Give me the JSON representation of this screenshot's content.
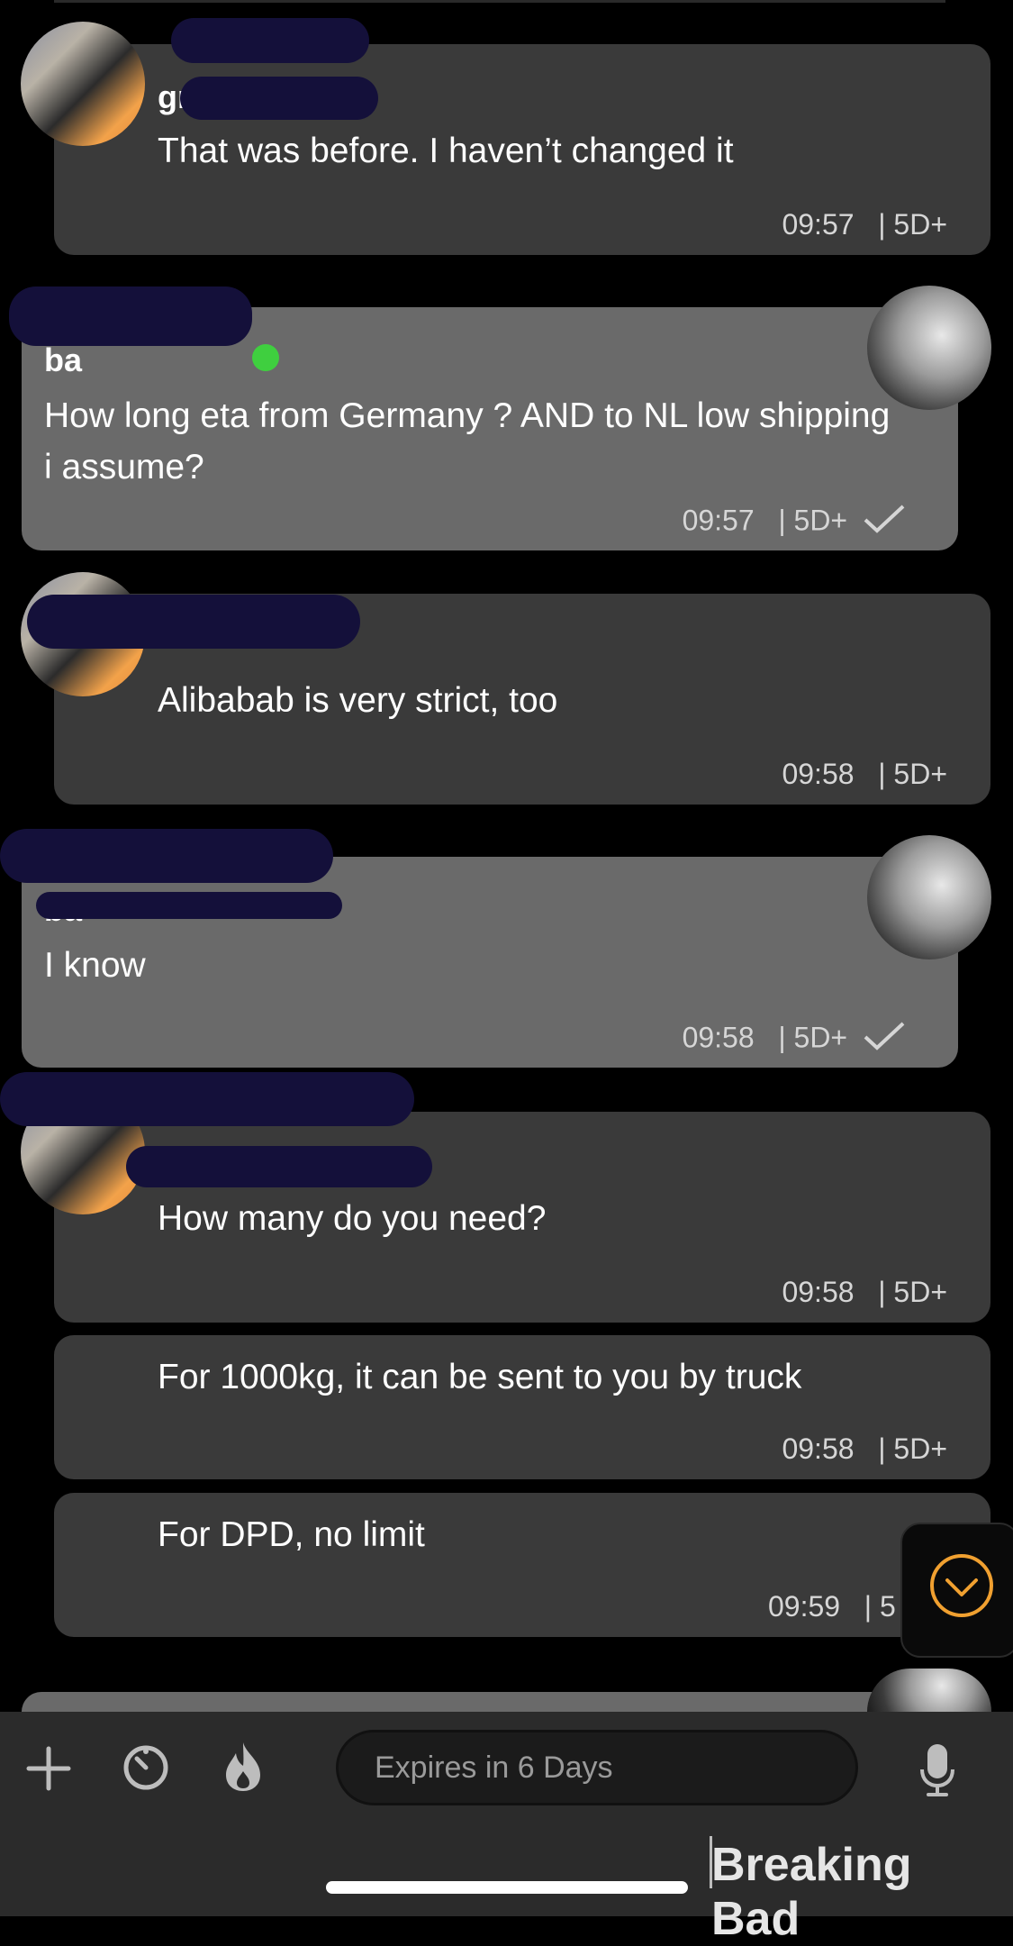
{
  "messages": [
    {
      "sender": "gr",
      "text": "That was before. I haven’t changed it",
      "time": "09:57",
      "age": "| 5D+"
    },
    {
      "sender": "ba",
      "text": "How long eta from Germany ? AND to NL low shipping i assume?",
      "time": "09:57",
      "age": "| 5D+"
    },
    {
      "sender": "",
      "text": "Alibabab is very strict, too",
      "time": "09:58",
      "age": "| 5D+"
    },
    {
      "sender": "ba",
      "text": "I know",
      "time": "09:58",
      "age": "| 5D+"
    },
    {
      "sender": "",
      "text": "How many do you need?",
      "time": "09:58",
      "age": "| 5D+"
    },
    {
      "sender": "",
      "text": "For 1000kg, it can be sent to you by truck",
      "time": "09:58",
      "age": "| 5D+"
    },
    {
      "sender": "",
      "text": "For DPD, no limit",
      "time": "09:59",
      "age": "| 5"
    }
  ],
  "composer": {
    "placeholder": "Expires in 6 Days"
  },
  "branding": {
    "label": "Breaking Bad"
  },
  "icons": {
    "add": "plus-icon",
    "timer": "timer-icon",
    "flame": "flame-icon",
    "mic": "microphone-icon",
    "scroll": "chevron-down-circle-icon",
    "read": "checkmark-icon"
  },
  "colors": {
    "accent": "#f0a030",
    "incoming_bubble": "#3a3a3a",
    "outgoing_bubble": "#6a6a6a"
  }
}
